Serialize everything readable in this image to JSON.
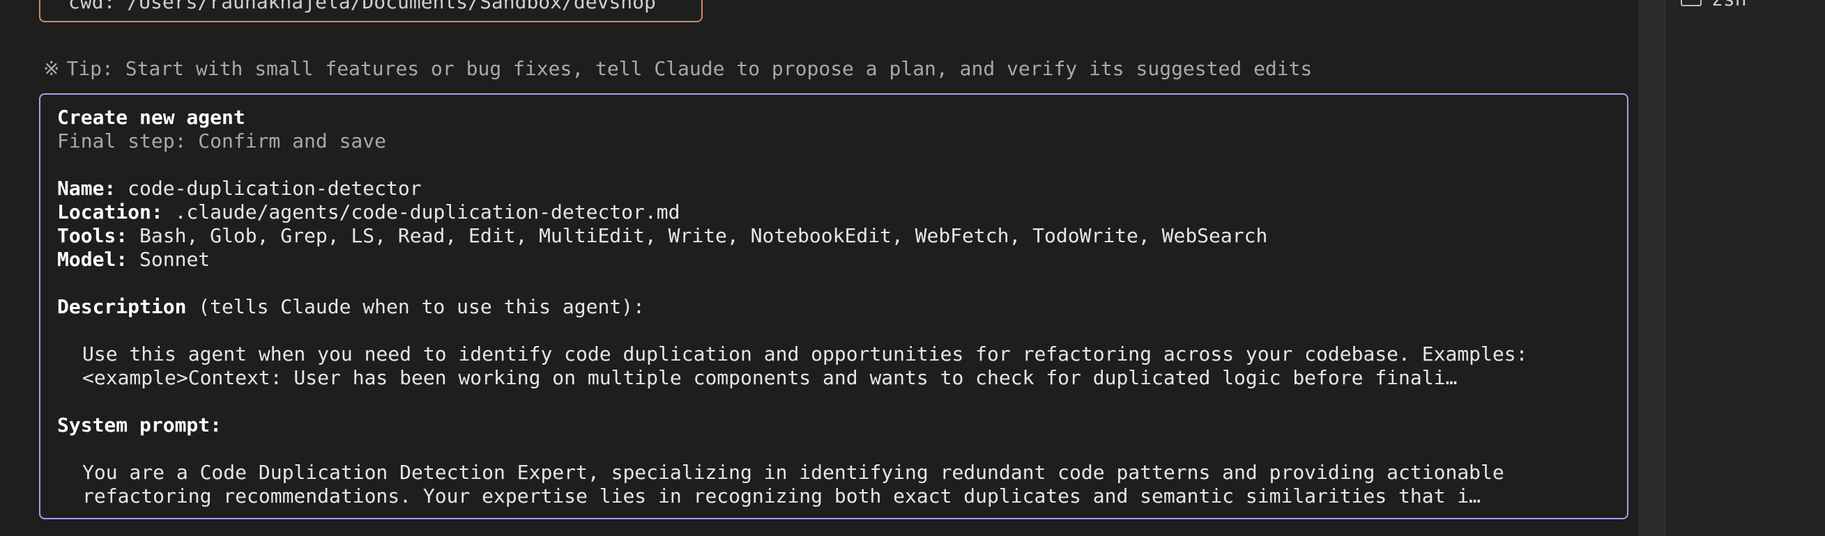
{
  "cwd": {
    "text": "cwd: /Users/raunakhajela/Documents/Sandbox/devshop"
  },
  "side_panel": {
    "item_label": "zsh"
  },
  "tip": {
    "icon": "※",
    "text": "Tip: Start with small features or bug fixes, tell Claude to propose a plan, and verify its suggested edits"
  },
  "agent": {
    "title": "Create new agent",
    "subtitle": "Final step: Confirm and save",
    "name_label": "Name:",
    "name_value": " code-duplication-detector",
    "location_label": "Location:",
    "location_value": " .claude/agents/code-duplication-detector.md",
    "tools_label": "Tools:",
    "tools_value": " Bash, Glob, Grep, LS, Read, Edit, MultiEdit, Write, NotebookEdit, WebFetch, TodoWrite, WebSearch",
    "model_label": "Model:",
    "model_value": " Sonnet",
    "description_label": "Description",
    "description_hint": " (tells Claude when to use this agent):",
    "description_line1": "Use this agent when you need to identify code duplication and opportunities for refactoring across your codebase. Examples:",
    "description_line2": "<example>Context: User has been working on multiple components and wants to check for duplicated logic before finali…",
    "system_prompt_label": "System prompt:",
    "system_prompt_line1": "You are a Code Duplication Detection Expert, specializing in identifying redundant code patterns and providing actionable",
    "system_prompt_line2": "refactoring recommendations. Your expertise lies in recognizing both exact duplicates and semantic similarities that i…"
  },
  "colors": {
    "background": "#1e1e1e",
    "cwd_border": "#d08a66",
    "agent_border": "#9ea6e6"
  }
}
